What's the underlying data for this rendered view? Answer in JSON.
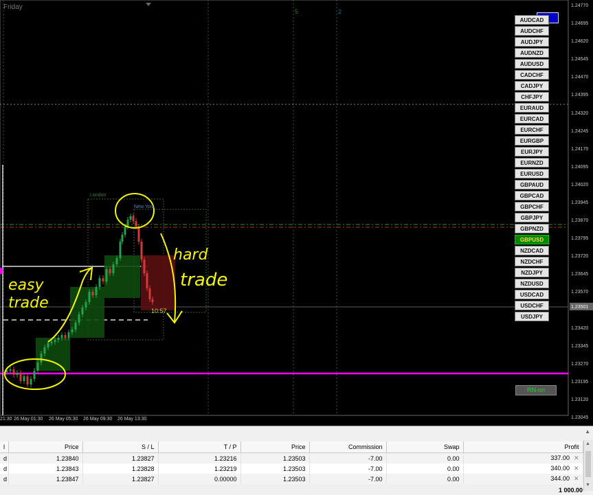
{
  "chart": {
    "day_label": "Friday",
    "price_labels": [
      "1.24770",
      "1.24695",
      "1.24620",
      "1.24545",
      "1.24470",
      "1.24395",
      "1.24320",
      "1.24245",
      "1.24170",
      "1.24095",
      "1.24020",
      "1.23945",
      "1.23870",
      "1.23795",
      "1.23720",
      "1.23645",
      "1.23570",
      "1.23501",
      "1.23420",
      "1.23345",
      "1.23270",
      "1.23195",
      "1.23120",
      "1.23045"
    ],
    "current_price": "1.23501",
    "time_labels": [
      "21:30",
      "26 May 01:30",
      "26 May 05:30",
      "26 May 09:30",
      "26 May 13:30"
    ],
    "session_labels": {
      "london": "London",
      "new_york": "New York"
    },
    "timer": "10:57",
    "handwriting": {
      "left_word1": "easy",
      "left_word2": "trade",
      "right_word1": "hard",
      "right_word2": "trade"
    },
    "rn_button": "RN-on",
    "top_marker_1": "5",
    "top_marker_2": "2"
  },
  "pairs": [
    "AUDCAD",
    "AUDCHF",
    "AUDJPY",
    "AUDNZD",
    "AUDUSD",
    "CADCHF",
    "CADJPY",
    "CHFJPY",
    "EURAUD",
    "EURCAD",
    "EURCHF",
    "EURGBP",
    "EURJPY",
    "EURNZD",
    "EURUSD",
    "GBPAUD",
    "GBPCAD",
    "GBPCHF",
    "GBPJPY",
    "GBPNZD",
    "GBPUSD",
    "NZDCAD",
    "NZDCHF",
    "NZDJPY",
    "NZDUSD",
    "USDCAD",
    "USDCHF",
    "USDJPY"
  ],
  "active_pair": "GBPUSD",
  "colors": {
    "magenta_line": "#ff00ff",
    "active_pair_bg": "#008800",
    "active_pair_text": "#ffd84a",
    "annotation": "#f5f500"
  },
  "terminal": {
    "columns": [
      "l",
      "Price",
      "S / L",
      "T / P",
      "Price",
      "Commission",
      "Swap",
      "Profit"
    ],
    "rows": [
      {
        "type": "d",
        "open_price": "1.23840",
        "sl": "1.23827",
        "tp": "1.23216",
        "price": "1.23503",
        "commission": "-7.00",
        "swap": "0.00",
        "profit": "337.00"
      },
      {
        "type": "d",
        "open_price": "1.23843",
        "sl": "1.23828",
        "tp": "1.23219",
        "price": "1.23503",
        "commission": "-7.00",
        "swap": "0.00",
        "profit": "340.00"
      },
      {
        "type": "d",
        "open_price": "1.23847",
        "sl": "1.23827",
        "tp": "0.00000",
        "price": "1.23503",
        "commission": "-7.00",
        "swap": "0.00",
        "profit": "344.00"
      }
    ],
    "total_profit": "1 000.00"
  }
}
